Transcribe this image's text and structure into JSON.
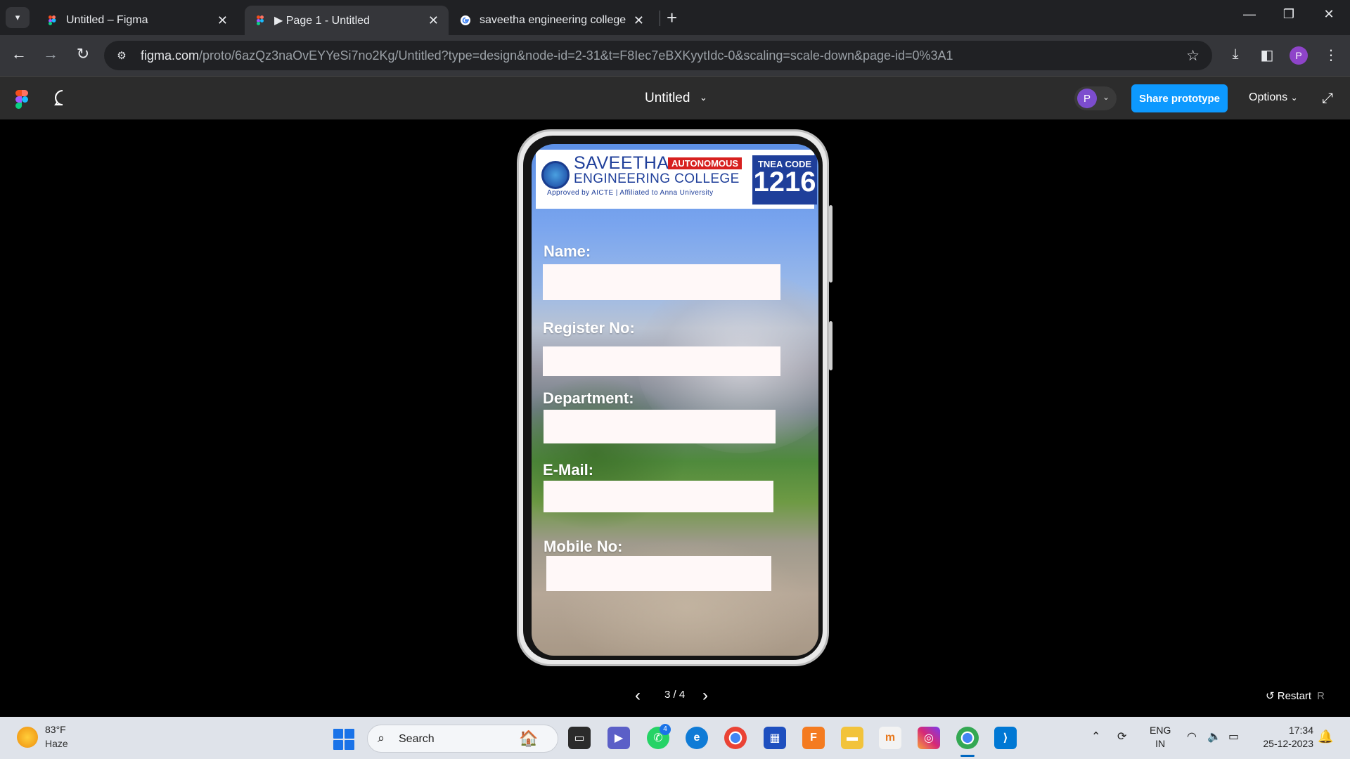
{
  "browser": {
    "tabs": [
      {
        "title": "Untitled – Figma",
        "icon": "figma-icon",
        "active": false
      },
      {
        "title": "▶ Page 1 - Untitled",
        "icon": "figma-icon",
        "active": true
      },
      {
        "title": "saveetha engineering college lo",
        "icon": "google-icon",
        "active": false
      }
    ],
    "new_tab": "+",
    "url_host": "figma.com",
    "url_path": "/proto/6azQz3naOvEYYeSi7no2Kg/Untitled?type=design&node-id=2-31&t=F8Iec7eBXKyytIdc-0&scaling=scale-down&page-id=0%3A1",
    "profile_initial": "P"
  },
  "figma": {
    "file_title": "Untitled",
    "avatar_initial": "P",
    "share_label": "Share prototype",
    "options_label": "Options",
    "pager": {
      "current": 3,
      "total": 4,
      "text": "3 / 4"
    },
    "restart_label": "Restart",
    "restart_key": "R"
  },
  "prototype": {
    "college_line1": "SAVEETHA",
    "college_line2": "ENGINEERING COLLEGE",
    "autonomous": "AUTONOMOUS",
    "approved": "Approved by AICTE | Affiliated to Anna University",
    "tnea_label": "TNEA CODE",
    "tnea_code": "1216",
    "fields": [
      {
        "label": "Name:",
        "value": ""
      },
      {
        "label": "Register No:",
        "value": ""
      },
      {
        "label": "Department:",
        "value": ""
      },
      {
        "label": "E-Mail:",
        "value": ""
      },
      {
        "label": "Mobile No:",
        "value": ""
      }
    ]
  },
  "taskbar": {
    "weather_temp": "83°F",
    "weather_desc": "Haze",
    "search_placeholder": "Search",
    "whatsapp_badge": "4",
    "lang_line1": "ENG",
    "lang_line2": "IN",
    "time": "17:34",
    "date": "25-12-2023"
  },
  "colors": {
    "share_button": "#0d99ff",
    "college_blue": "#1f3f9a",
    "autonomous_red": "#d7201f"
  }
}
